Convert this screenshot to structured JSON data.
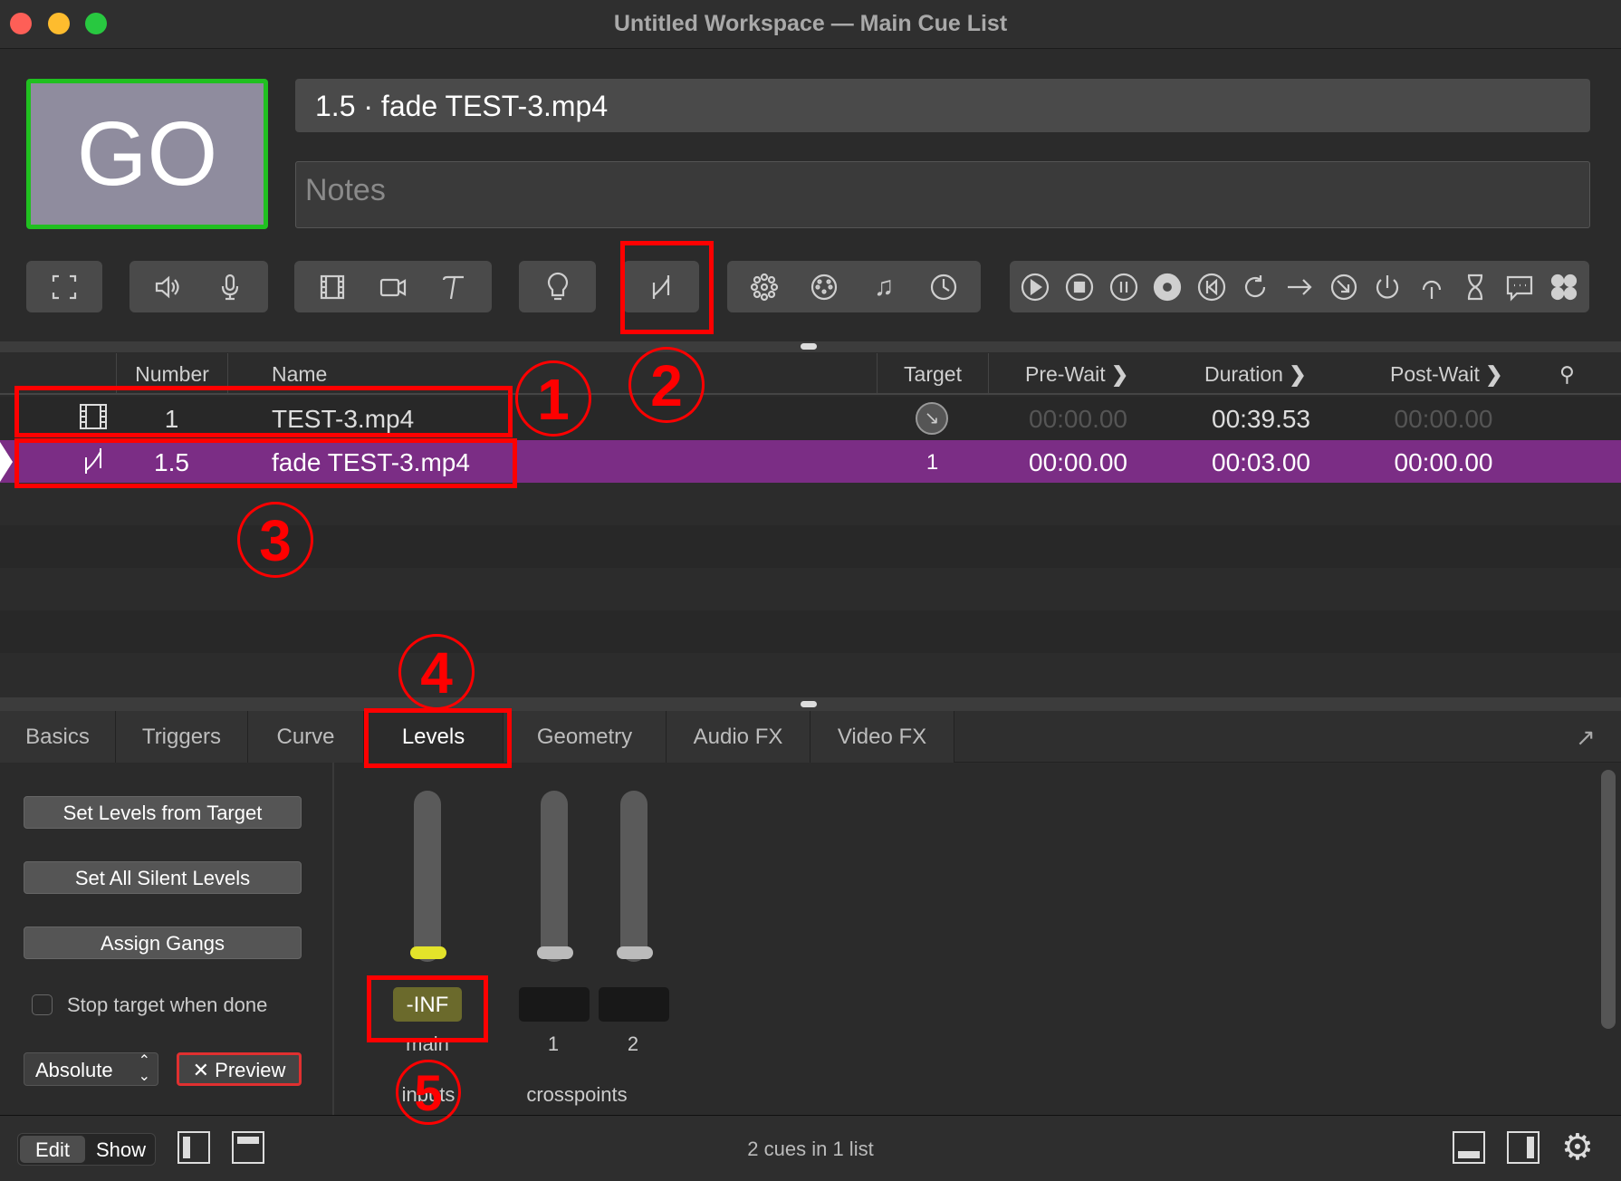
{
  "window": {
    "title": "Untitled Workspace — Main Cue List"
  },
  "go": {
    "label": "GO"
  },
  "cue_name": "1.5 · fade TEST-3.mp4",
  "notes": {
    "placeholder": "Notes"
  },
  "toolbar": {
    "groups": [
      [
        "group-icon"
      ],
      [
        "audio-icon",
        "mic-icon"
      ],
      [
        "video-icon",
        "camera-icon",
        "text-icon"
      ],
      [
        "light-icon"
      ],
      [
        "fade-icon"
      ],
      [
        "network-icon",
        "midi-icon",
        "music-icon",
        "timecode-icon"
      ],
      [
        "start-icon",
        "stop-icon",
        "pause-icon",
        "load-icon",
        "reset-icon",
        "goto-icon",
        "target-icon",
        "arm-icon",
        "disarm-icon",
        "devamp-icon",
        "wait-icon",
        "memo-icon",
        "script-icon"
      ]
    ]
  },
  "table": {
    "headers": {
      "number": "Number",
      "name": "Name",
      "target": "Target",
      "prewait": "Pre-Wait",
      "duration": "Duration",
      "postwait": "Post-Wait"
    },
    "rows": [
      {
        "type": "video",
        "number": "1",
        "name": "TEST-3.mp4",
        "target": "",
        "prewait": "00:00.00",
        "duration": "00:39.53",
        "postwait": "00:00.00",
        "selected": false
      },
      {
        "type": "fade",
        "number": "1.5",
        "name": "fade TEST-3.mp4",
        "target": "1",
        "prewait": "00:00.00",
        "duration": "00:03.00",
        "postwait": "00:00.00",
        "selected": true
      }
    ]
  },
  "tabs": [
    "Basics",
    "Triggers",
    "Curve",
    "Levels",
    "Geometry",
    "Audio FX",
    "Video FX"
  ],
  "active_tab": "Levels",
  "levels": {
    "buttons": [
      "Set Levels from Target",
      "Set All Silent Levels",
      "Assign Gangs"
    ],
    "stop_target_label": "Stop target when done",
    "stop_target_checked": false,
    "mode": "Absolute",
    "preview_label": "✕ Preview",
    "main_value": "-INF",
    "main_label": "main",
    "inputs_label": "inputs",
    "crosspoints": [
      {
        "label": "1",
        "value": ""
      },
      {
        "label": "2",
        "value": ""
      }
    ],
    "crosspoints_label": "crosspoints"
  },
  "status": {
    "edit": "Edit",
    "show": "Show",
    "text": "2 cues in 1 list"
  },
  "annotations": [
    "1",
    "2",
    "3",
    "4",
    "5"
  ],
  "colors": {
    "selected_row": "#7b2d85",
    "go_border": "#20c020",
    "annotation": "#ff0000",
    "main_fader_knob": "#e3e32a"
  }
}
